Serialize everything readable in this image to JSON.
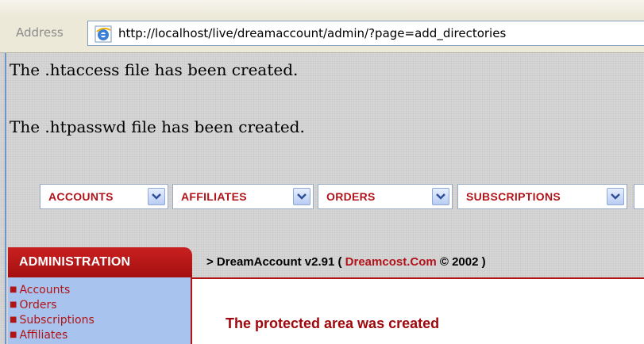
{
  "address_bar": {
    "label": "Address",
    "url": "http://localhost/live/dreamaccount/admin/?page=add_directories",
    "icon": "ie-page-icon"
  },
  "messages": [
    "The .htaccess file has been created.",
    "The .htpasswd file has been created."
  ],
  "menus": [
    {
      "label": "ACCOUNTS"
    },
    {
      "label": "AFFILIATES"
    },
    {
      "label": "ORDERS"
    },
    {
      "label": "SUBSCRIPTIONS"
    }
  ],
  "admin": {
    "title": "ADMINISTRATION",
    "items": [
      "Accounts",
      "Orders",
      "Subscriptions",
      "Affiliates"
    ]
  },
  "header": {
    "prefix": "> DreamAccount v2.91 ( ",
    "link": "Dreamcost.Com",
    "suffix": " © 2002 )"
  },
  "result_message": "The protected area was created",
  "colors": {
    "accent_red": "#b2131a",
    "sidebar_blue": "#a9c3ef",
    "menu_button_blue": "#b8ccf2"
  }
}
